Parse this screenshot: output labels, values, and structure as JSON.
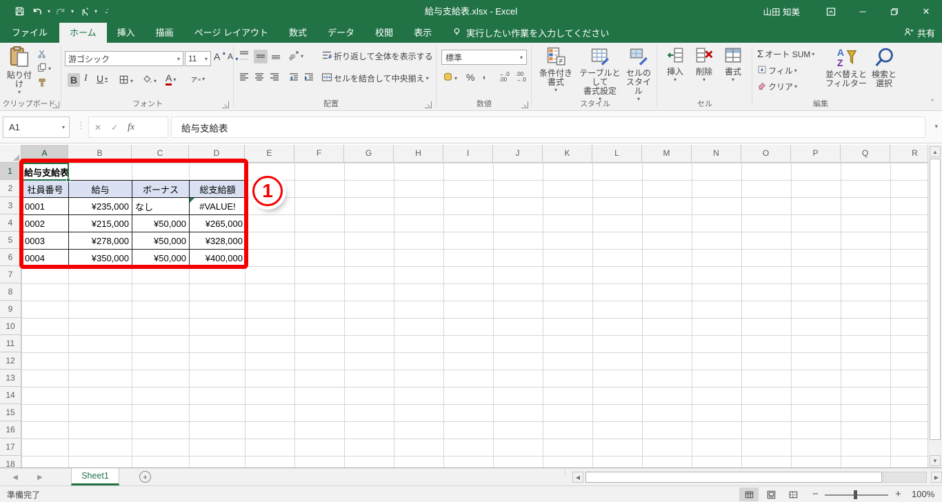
{
  "titlebar": {
    "title": "給与支給表.xlsx  -  Excel",
    "user": "山田 知美"
  },
  "tabs": {
    "file": "ファイル",
    "home": "ホーム",
    "insert": "挿入",
    "draw": "描画",
    "page_layout": "ページ レイアウト",
    "formulas": "数式",
    "data": "データ",
    "review": "校閲",
    "view": "表示",
    "tell_me": "実行したい作業を入力してください",
    "share": "共有"
  },
  "ribbon": {
    "paste": "貼り付け",
    "font_name": "游ゴシック",
    "font_size": "11",
    "bold": "B",
    "italic": "I",
    "underline": "U",
    "wrap_text": "折り返して全体を表示する",
    "merge_center": "セルを結合して中央揃え",
    "number_format": "標準",
    "percent": "%",
    "comma": ",",
    "inc_decimal": "←.0\n.00",
    "dec_decimal": ".00\n→.0",
    "conditional": "条件付き\n書式",
    "format_table": "テーブルとして\n書式設定",
    "cell_styles": "セルの\nスタイル",
    "insert": "挿入",
    "delete": "削除",
    "format": "書式",
    "autosum": "オート SUM",
    "fill": "フィル",
    "clear": "クリア",
    "sort_filter": "並べ替えと\nフィルター",
    "find_select": "検索と\n選択",
    "sigma": "Σ",
    "groups": {
      "clipboard": "クリップボード",
      "font": "フォント",
      "alignment": "配置",
      "number": "数値",
      "styles": "スタイル",
      "cells": "セル",
      "editing": "編集"
    }
  },
  "formula_bar": {
    "name_box": "A1",
    "fx": "fx",
    "cancel": "✕",
    "enter": "✓",
    "formula": "給与支給表"
  },
  "grid": {
    "col_headers": [
      "A",
      "B",
      "C",
      "D",
      "E",
      "F",
      "G",
      "H",
      "I",
      "J",
      "K",
      "L",
      "M",
      "N",
      "O",
      "P",
      "Q",
      "R"
    ],
    "row_count": 18,
    "selected_cell": "A1"
  },
  "table": {
    "title": "給与支給表",
    "headers": [
      "社員番号",
      "給与",
      "ボーナス",
      "総支給額"
    ],
    "rows": [
      [
        "0001",
        "¥235,000",
        "なし",
        "#VALUE!"
      ],
      [
        "0002",
        "¥215,000",
        "¥50,000",
        "¥265,000"
      ],
      [
        "0003",
        "¥278,000",
        "¥50,000",
        "¥328,000"
      ],
      [
        "0004",
        "¥350,000",
        "¥50,000",
        "¥400,000"
      ]
    ],
    "header_fill": "#D9E1F2",
    "error_value": "#VALUE!"
  },
  "annotation": {
    "label": "1",
    "color": "#F40000"
  },
  "sheet_bar": {
    "active_tab": "Sheet1",
    "add_sheet": "+"
  },
  "status_bar": {
    "ready": "準備完了",
    "zoom_level": "100%"
  }
}
